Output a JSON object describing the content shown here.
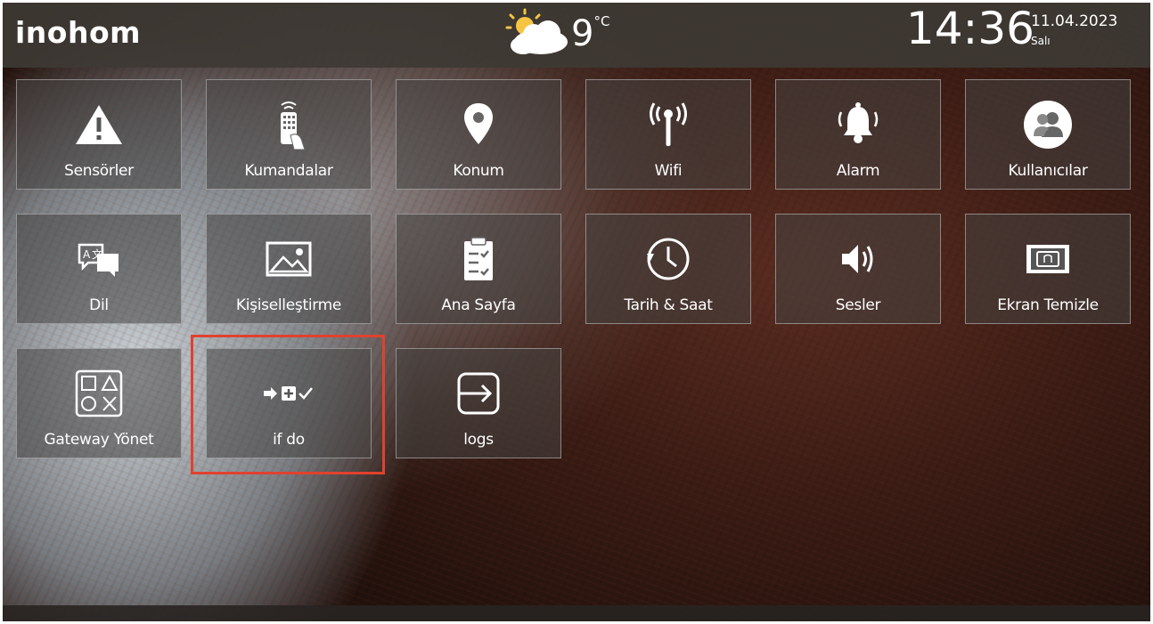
{
  "brand": "inohom",
  "weather": {
    "icon": "partly-cloudy-icon",
    "temperature": "9",
    "unit": "°C"
  },
  "clock": {
    "time": "14:36",
    "date": "11.04.2023",
    "day": "Salı"
  },
  "tiles": [
    {
      "label": "Sensörler",
      "icon": "warning-icon"
    },
    {
      "label": "Kumandalar",
      "icon": "remote-control-icon"
    },
    {
      "label": "Konum",
      "icon": "location-pin-icon"
    },
    {
      "label": "Wifi",
      "icon": "wifi-antenna-icon"
    },
    {
      "label": "Alarm",
      "icon": "alarm-bell-icon"
    },
    {
      "label": "Kullanıcılar",
      "icon": "users-icon"
    },
    {
      "label": "Dil",
      "icon": "language-icon"
    },
    {
      "label": "Kişiselleştirme",
      "icon": "image-icon"
    },
    {
      "label": "Ana Sayfa",
      "icon": "clipboard-checklist-icon"
    },
    {
      "label": "Tarih & Saat",
      "icon": "clock-icon"
    },
    {
      "label": "Sesler",
      "icon": "speaker-icon"
    },
    {
      "label": "Ekran Temizle",
      "icon": "screen-clean-icon"
    },
    {
      "label": "Gateway Yönet",
      "icon": "gateway-shapes-icon"
    },
    {
      "label": "if do",
      "icon": "if-do-icon"
    },
    {
      "label": "logs",
      "icon": "logs-icon"
    }
  ],
  "highlight_color": "#e0412f"
}
